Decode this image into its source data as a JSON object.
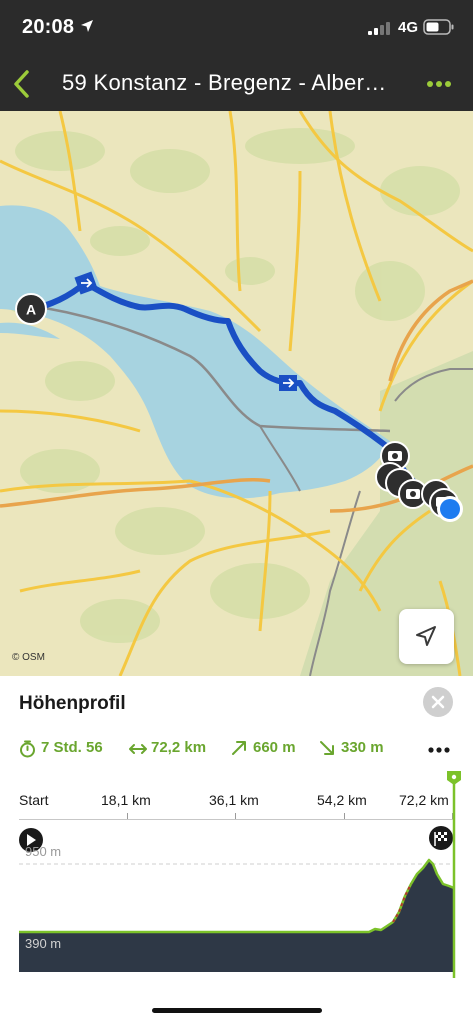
{
  "status_bar": {
    "time": "20:08",
    "network": "4G"
  },
  "header": {
    "title": "59 Konstanz - Bregenz - Alber…"
  },
  "map": {
    "attribution": "© OSM",
    "start_marker": "A"
  },
  "panel": {
    "title": "Höhenprofil",
    "stats": {
      "duration": "7 Std. 56",
      "distance": "72,2 km",
      "ascent": "660 m",
      "descent": "330 m"
    },
    "axis": {
      "ticks": [
        "Start",
        "18,1 km",
        "36,1 km",
        "54,2 km",
        "72,2 km"
      ]
    },
    "elevation": {
      "max_label": "950 m",
      "min_label": "390 m"
    }
  },
  "colors": {
    "accent": "#7cc22a",
    "route": "#1a4fc4",
    "lake": "#a7d3e0",
    "header_bg": "#2b2b2b"
  },
  "icons": [
    "back-icon",
    "more-icon",
    "locate-icon",
    "close-icon",
    "timer-icon",
    "distance-icon",
    "ascent-icon",
    "descent-icon",
    "start-flag-icon",
    "finish-flag-icon"
  ]
}
